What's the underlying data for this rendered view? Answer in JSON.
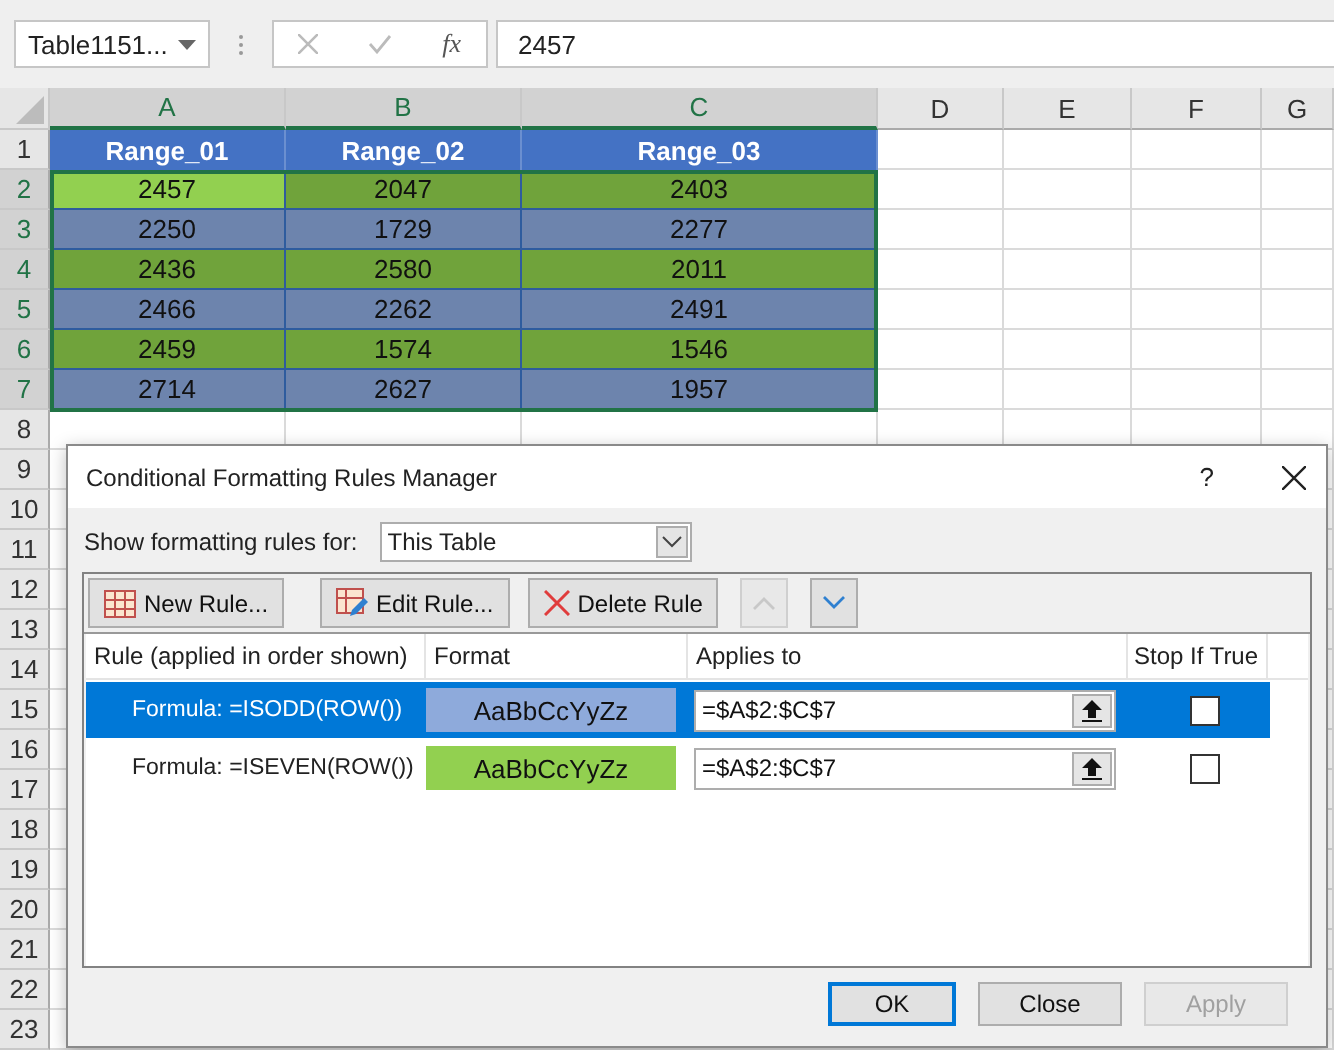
{
  "formula_bar": {
    "name_box": "Table1151...",
    "function_button": "fx",
    "value": "2457"
  },
  "sheet": {
    "columns": [
      {
        "label": "A",
        "selected": true
      },
      {
        "label": "B",
        "selected": true
      },
      {
        "label": "C",
        "selected": true
      },
      {
        "label": "D",
        "selected": false
      },
      {
        "label": "E",
        "selected": false
      },
      {
        "label": "F",
        "selected": false
      },
      {
        "label": "G",
        "selected": false
      }
    ],
    "row_numbers": [
      {
        "label": "1",
        "selected": false
      },
      {
        "label": "2",
        "selected": true
      },
      {
        "label": "3",
        "selected": true
      },
      {
        "label": "4",
        "selected": true
      },
      {
        "label": "5",
        "selected": true
      },
      {
        "label": "6",
        "selected": true
      },
      {
        "label": "7",
        "selected": true
      },
      {
        "label": "8",
        "selected": false
      },
      {
        "label": "9",
        "selected": false
      },
      {
        "label": "10",
        "selected": false
      },
      {
        "label": "11",
        "selected": false
      },
      {
        "label": "12",
        "selected": false
      },
      {
        "label": "13",
        "selected": false
      },
      {
        "label": "14",
        "selected": false
      },
      {
        "label": "15",
        "selected": false
      },
      {
        "label": "16",
        "selected": false
      },
      {
        "label": "17",
        "selected": false
      },
      {
        "label": "18",
        "selected": false
      },
      {
        "label": "19",
        "selected": false
      },
      {
        "label": "20",
        "selected": false
      },
      {
        "label": "21",
        "selected": false
      },
      {
        "label": "22",
        "selected": false
      },
      {
        "label": "23",
        "selected": false
      }
    ],
    "table_headers": [
      "Range_01",
      "Range_02",
      "Range_03"
    ],
    "table_rows": [
      {
        "color": "#70a33b",
        "cells": [
          {
            "text": "2457",
            "selected": true
          },
          {
            "text": "2047",
            "selected": false
          },
          {
            "text": "2403",
            "selected": false
          }
        ]
      },
      {
        "color": "#6d84ad",
        "cells": [
          {
            "text": "2250",
            "selected": false
          },
          {
            "text": "1729",
            "selected": false
          },
          {
            "text": "2277",
            "selected": false
          }
        ]
      },
      {
        "color": "#70a33b",
        "cells": [
          {
            "text": "2436",
            "selected": false
          },
          {
            "text": "2580",
            "selected": false
          },
          {
            "text": "2011",
            "selected": false
          }
        ]
      },
      {
        "color": "#6d84ad",
        "cells": [
          {
            "text": "2466",
            "selected": false
          },
          {
            "text": "2262",
            "selected": false
          },
          {
            "text": "2491",
            "selected": false
          }
        ]
      },
      {
        "color": "#70a33b",
        "cells": [
          {
            "text": "2459",
            "selected": false
          },
          {
            "text": "1574",
            "selected": false
          },
          {
            "text": "1546",
            "selected": false
          }
        ]
      },
      {
        "color": "#6d84ad",
        "cells": [
          {
            "text": "2714",
            "selected": false
          },
          {
            "text": "2627",
            "selected": false
          },
          {
            "text": "1957",
            "selected": false
          }
        ]
      }
    ]
  },
  "dialog": {
    "title": "Conditional Formatting Rules Manager",
    "help": "?",
    "show_rules_for": {
      "label": "Show formatting rules for:",
      "value": "This Table"
    },
    "toolbar": [
      {
        "kind": "new",
        "label": "New Rule...",
        "disabled": false
      },
      {
        "kind": "edit",
        "label": "Edit Rule...",
        "disabled": false
      },
      {
        "kind": "delete",
        "label": "Delete Rule",
        "disabled": false
      },
      {
        "kind": "up",
        "disabled": true
      },
      {
        "kind": "down",
        "disabled": false
      }
    ],
    "columns": [
      "Rule (applied in order shown)",
      "Format",
      "Applies to",
      "Stop If True"
    ],
    "rules": [
      {
        "rule": "Formula: =ISODD(ROW())",
        "format_preview": "AaBbCcYyZz",
        "color": "#8eaadb",
        "applies_to": "=$A$2:$C$7",
        "stop_if_true": false,
        "selected": true
      },
      {
        "rule": "Formula: =ISEVEN(ROW())",
        "format_preview": "AaBbCcYyZz",
        "color": "#92d050",
        "applies_to": "=$A$2:$C$7",
        "stop_if_true": false,
        "selected": false
      }
    ],
    "buttons": [
      {
        "label": "OK",
        "default": true,
        "disabled": false
      },
      {
        "label": "Close",
        "default": false,
        "disabled": false
      },
      {
        "label": "Apply",
        "default": false,
        "disabled": true
      }
    ]
  }
}
